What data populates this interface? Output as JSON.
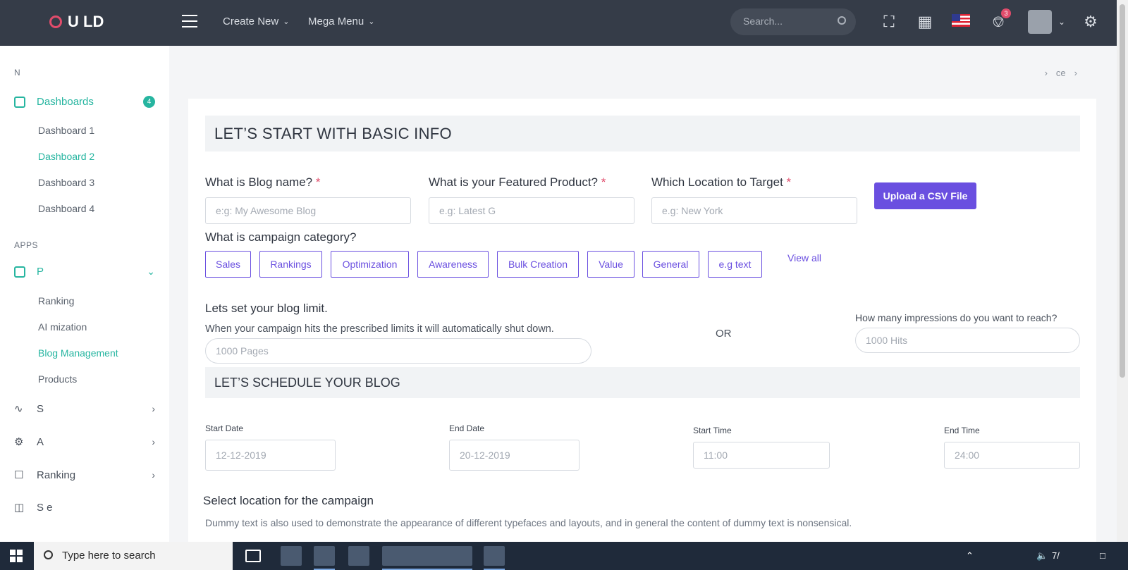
{
  "header": {
    "brand": "U  LD",
    "nav": [
      {
        "label": "Create New"
      },
      {
        "label": "Mega Menu"
      }
    ],
    "search_placeholder": "Search...",
    "notification_count": "3"
  },
  "sidebar": {
    "section_nav": "N",
    "dashboards": {
      "label": "Dashboards",
      "badge": "4"
    },
    "dashboard_items": [
      "Dashboard 1",
      "Dashboard 2",
      "Dashboard 3",
      "Dashboard 4"
    ],
    "section_apps": "APPS",
    "products": {
      "label": "P"
    },
    "product_items": [
      "Ranking",
      "AI  mization",
      "Blog Management",
      "Products"
    ],
    "other_items": [
      "S",
      "A",
      "Ranking",
      "S  e"
    ]
  },
  "page": {
    "title": "",
    "breadcrumbs": [
      "",
      "ce",
      ""
    ]
  },
  "form": {
    "basic_info_title": "LET’S START WITH BASIC INFO",
    "blog_name_label": "What is Blog name?",
    "blog_name_placeholder": "e:g: My Awesome Blog",
    "product_label": "What is your Featured Product?",
    "product_placeholder": "e.g: Latest G",
    "location_label": "Which Location to Target",
    "location_placeholder": "e.g: New York",
    "required_mark": "*",
    "upload_button": "Upload a CSV File",
    "category_label": "What is campaign category?",
    "categories": [
      "Sales",
      "Rankings",
      "Optimization",
      "Awareness",
      "Bulk Creation",
      "Value",
      "General",
      "e.g text"
    ],
    "view_all": "View all",
    "limit_title": "Lets set your blog limit.",
    "limit_desc": "When your campaign hits the prescribed limits it will automatically shut down.",
    "limit_placeholder": "1000 Pages",
    "or_label": "OR",
    "impressions_label": "How many impressions do you want to reach?",
    "impressions_placeholder": "1000 Hits",
    "schedule_title": "LET’S SCHEDULE YOUR BLOG",
    "start_date_label": "Start Date",
    "start_date_value": "12-12-2019",
    "end_date_label": "End Date",
    "end_date_value": "20-12-2019",
    "start_time_label": "Start Time",
    "start_time_value": "11:00",
    "end_time_label": "End Time",
    "end_time_value": "24:00",
    "location_section_title": "Select location for the campaign",
    "location_section_desc": "Dummy text is also used to demonstrate the appearance of different typefaces and layouts, and in general the content of dummy text is nonsensical."
  },
  "taskbar": {
    "search_placeholder": "Type here to search",
    "clock": "7/"
  }
}
